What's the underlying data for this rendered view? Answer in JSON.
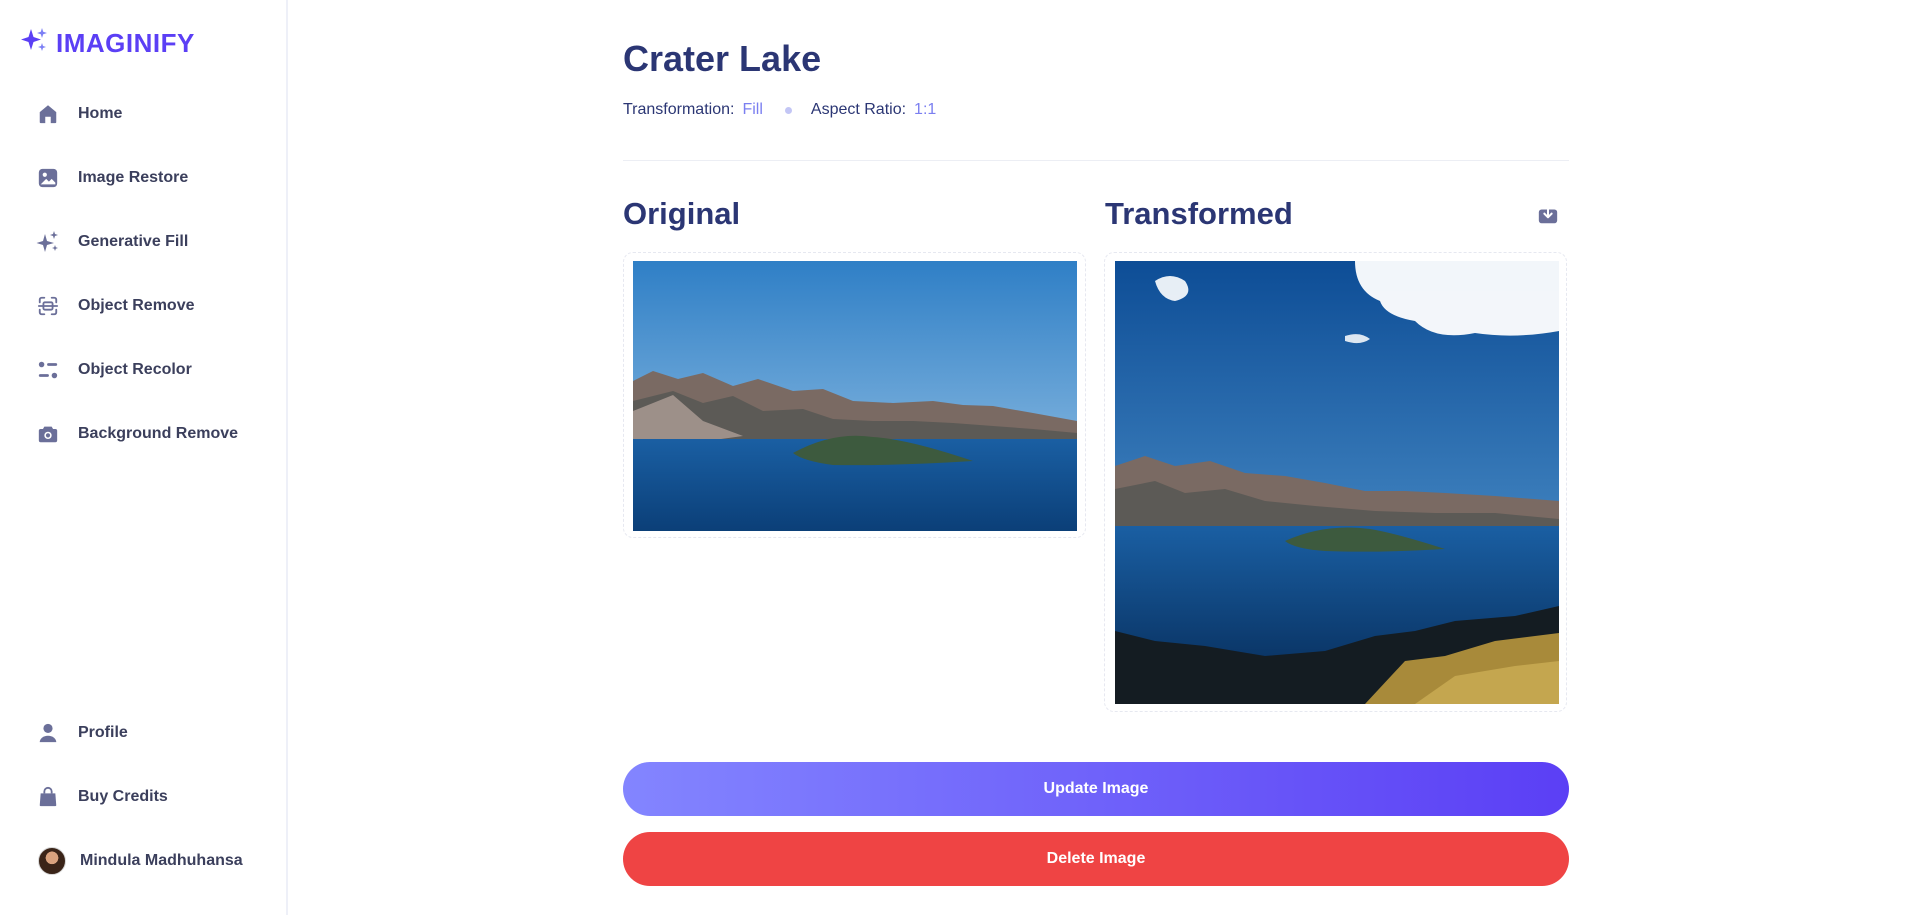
{
  "app": {
    "name": "IMAGINIFY"
  },
  "sidebar": {
    "items": [
      {
        "label": "Home",
        "icon": "home-icon"
      },
      {
        "label": "Image Restore",
        "icon": "image-icon"
      },
      {
        "label": "Generative Fill",
        "icon": "sparkles-icon"
      },
      {
        "label": "Object Remove",
        "icon": "scan-icon"
      },
      {
        "label": "Object Recolor",
        "icon": "filter-icon"
      },
      {
        "label": "Background Remove",
        "icon": "camera-icon"
      }
    ],
    "bottom_items": [
      {
        "label": "Profile",
        "icon": "user-icon"
      },
      {
        "label": "Buy Credits",
        "icon": "bag-icon"
      }
    ],
    "user": {
      "name": "Mindula Madhuhansa"
    }
  },
  "page": {
    "title": "Crater Lake",
    "transformation_label": "Transformation:",
    "transformation_value": "Fill",
    "aspect_label": "Aspect Ratio:",
    "aspect_value": "1:1"
  },
  "original": {
    "heading": "Original"
  },
  "transformed": {
    "heading": "Transformed"
  },
  "actions": {
    "update_label": "Update Image",
    "delete_label": "Delete Image"
  },
  "colors": {
    "brand": "#5b3ff5",
    "heading": "#2b3674",
    "accent_value": "#7b7ff0",
    "danger": "#ef4444",
    "icon": "#6b6f99"
  }
}
